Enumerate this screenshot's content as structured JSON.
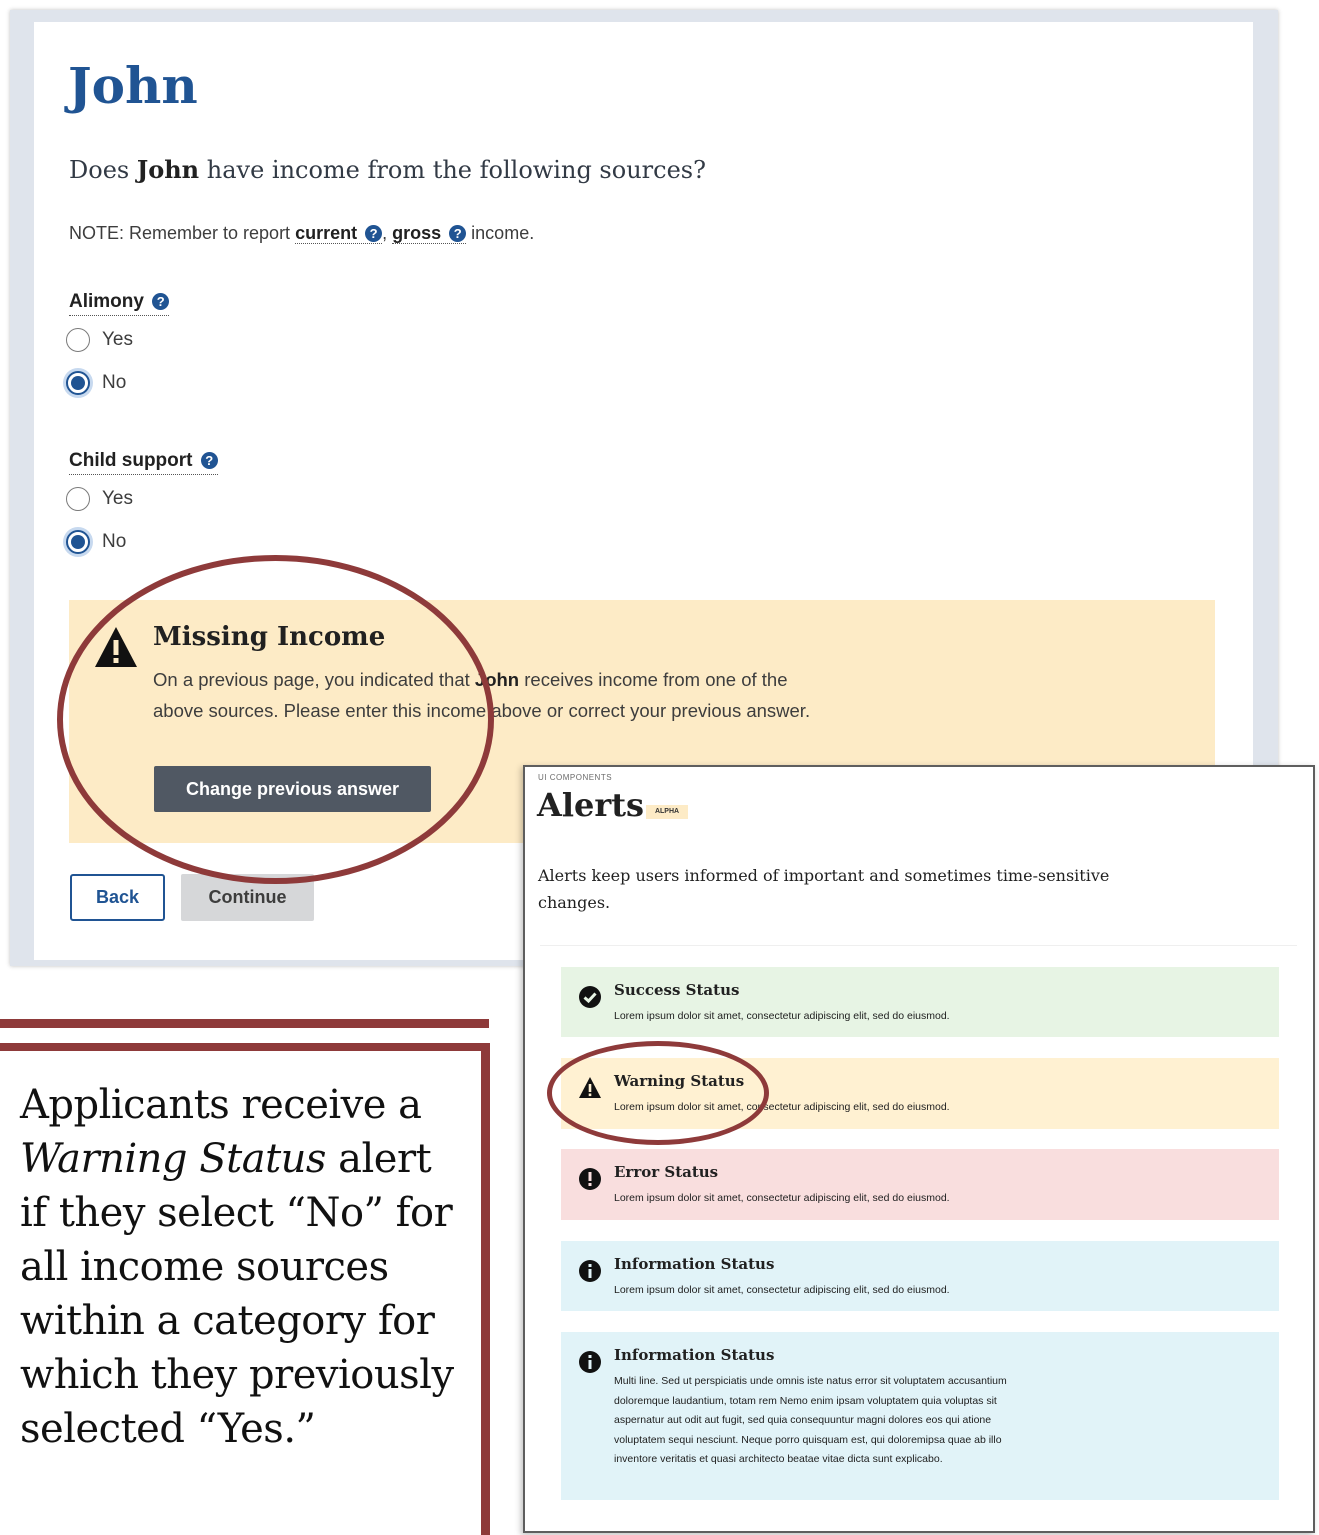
{
  "form": {
    "title": "John",
    "question_prefix": "Does ",
    "question_name": "John",
    "question_suffix": " have income from the following sources?",
    "note_prefix": "NOTE: Remember to report ",
    "note_current": "current",
    "note_sep": ", ",
    "note_gross": "gross",
    "note_suffix": " income.",
    "help_icon": "question-circle-icon",
    "groups": [
      {
        "label": "Alimony",
        "options": [
          {
            "label": "Yes",
            "checked": false
          },
          {
            "label": "No",
            "checked": true
          }
        ]
      },
      {
        "label": "Child support",
        "options": [
          {
            "label": "Yes",
            "checked": false
          },
          {
            "label": "No",
            "checked": true
          }
        ]
      }
    ],
    "warning": {
      "heading": "Missing Income",
      "text_before": "On a previous page, you indicated that ",
      "text_name": "John",
      "text_after": " receives income from one of the above sources. Please enter this income above or correct your previous answer.",
      "button": "Change previous answer",
      "icon": "warning-triangle-icon"
    },
    "back_button": "Back",
    "continue_button": "Continue"
  },
  "caption": {
    "line1": "Applicants receive a ",
    "italic": "Warning Status",
    "line2": " alert if they select “No” for all income sources within a category for which they previously selected “Yes.”"
  },
  "alerts_doc": {
    "eyebrow": "UI COMPONENTS",
    "title": "Alerts",
    "badge": "ALPHA",
    "description": "Alerts keep users informed of important and sometimes time-sensitive changes.",
    "items": [
      {
        "heading": "Success Status",
        "body": "Lorem ipsum dolor sit amet, consectetur adipiscing elit, sed do eiusmod.",
        "icon": "check-circle-icon"
      },
      {
        "heading": "Warning Status",
        "body": "Lorem ipsum dolor sit amet, consectetur adipiscing elit, sed do eiusmod.",
        "icon": "warning-triangle-icon"
      },
      {
        "heading": "Error Status",
        "body": "Lorem ipsum dolor sit amet, consectetur adipiscing elit, sed do eiusmod.",
        "icon": "exclamation-circle-icon"
      },
      {
        "heading": "Information Status",
        "body": "Lorem ipsum dolor sit amet, consectetur adipiscing elit, sed do eiusmod.",
        "icon": "info-circle-icon"
      },
      {
        "heading": "Information Status",
        "body": "Multi line. Sed ut perspiciatis unde omnis iste natus error sit voluptatem accusantium doloremque laudantium, totam rem Nemo enim ipsam voluptatem quia voluptas sit aspernatur aut odit aut fugit, sed quia consequuntur magni dolores eos qui atione voluptatem sequi nesciunt. Neque porro quisquam est, qui doloremipsa quae ab illo inventore veritatis et quasi architecto beatae vitae dicta sunt explicabo.",
        "icon": "info-circle-icon"
      }
    ]
  },
  "colors": {
    "primary_blue": "#205493",
    "annotation_red": "#8e3a3a",
    "warning_bg": "#fdebc6",
    "success_bg": "#e7f4e4",
    "error_bg": "#f9dede",
    "info_bg": "#e1f3f8"
  }
}
